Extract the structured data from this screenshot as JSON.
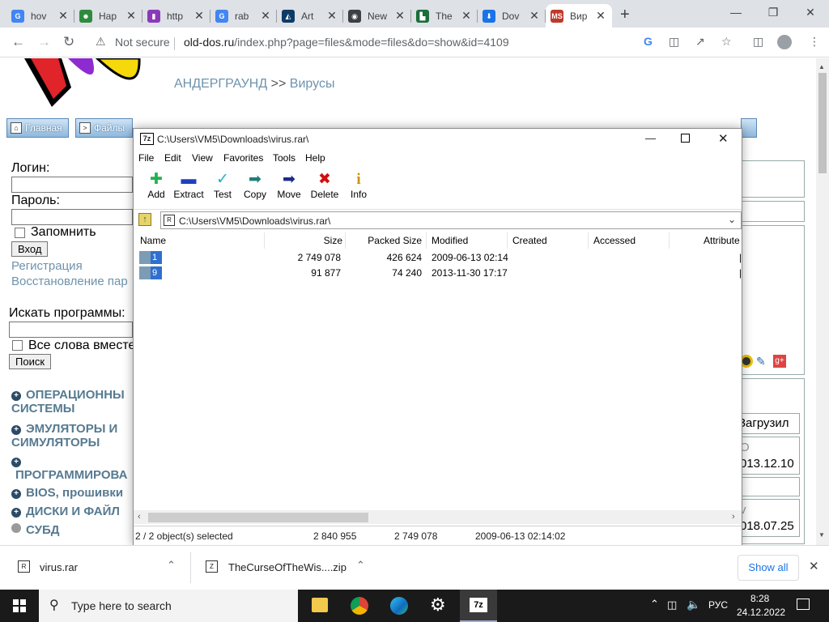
{
  "browser": {
    "tabs": [
      {
        "title": "hov",
        "fav": "#4285f4",
        "glyph": "G"
      },
      {
        "title": "Hap",
        "fav": "#2e8b3e",
        "glyph": "☻"
      },
      {
        "title": "http",
        "fav": "#8a3ab9",
        "glyph": "▮"
      },
      {
        "title": "rab",
        "fav": "#4285f4",
        "glyph": "G"
      },
      {
        "title": "Art",
        "fav": "#0d3b66",
        "glyph": "◭"
      },
      {
        "title": "New",
        "fav": "#3c4043",
        "glyph": "◉"
      },
      {
        "title": "The",
        "fav": "#1b6e3b",
        "glyph": "▙"
      },
      {
        "title": "Dov",
        "fav": "#1a73e8",
        "glyph": "⬇"
      },
      {
        "title": "Вир",
        "fav": "#c0392b",
        "glyph": "MS"
      }
    ],
    "new_tab": "+",
    "url_security": "Not secure",
    "url_host": "old-dos.ru",
    "url_path": "/index.php?page=files&mode=files&do=show&id=4109"
  },
  "site": {
    "breadcrumb_1": "АНДЕРГРАУНД",
    "breadcrumb_sep": ">>",
    "breadcrumb_2": "Вирусы",
    "nav": [
      "Главная",
      "Файлы"
    ],
    "login_label": "Логин:",
    "password_label": "Пароль:",
    "remember_label": "Запомнить",
    "login_button": "Вход",
    "register_link": "Регистрация",
    "restore_link": "Восстановление пар",
    "search_label": "Искать программы:",
    "allwords_label": "Все слова вместе",
    "search_button": "Поиск",
    "categories": [
      "ОПЕРАЦИОННЫ СИСТЕМЫ",
      "ЭМУЛЯТОРЫ И СИМУЛЯТОРЫ",
      "ПРОГРАММИРОВА",
      "BIOS, прошивки",
      "ДИСКИ И ФАЙЛ",
      "СУБД"
    ],
    "right_uploaded": "Загрузил",
    "right_date1": "013.12.10",
    "right_date2": "018.07.25",
    "right_o": "O",
    "right_v": "v"
  },
  "sevenzip": {
    "title": "C:\\Users\\VM5\\Downloads\\virus.rar\\",
    "menu": [
      "File",
      "Edit",
      "View",
      "Favorites",
      "Tools",
      "Help"
    ],
    "toolbar": [
      {
        "label": "Add",
        "icon": "plus-icon",
        "color": "#22b14c",
        "glyph": "✚"
      },
      {
        "label": "Extract",
        "icon": "minus-icon",
        "color": "#1f3fbf",
        "glyph": "▬"
      },
      {
        "label": "Test",
        "icon": "check-icon",
        "color": "#20b2c2",
        "glyph": "✓"
      },
      {
        "label": "Copy",
        "icon": "copy-arrow-icon",
        "color": "#1e7d7d",
        "glyph": "➡"
      },
      {
        "label": "Move",
        "icon": "move-arrow-icon",
        "color": "#1b2a8c",
        "glyph": "➡"
      },
      {
        "label": "Delete",
        "icon": "delete-icon",
        "color": "#d01010",
        "glyph": "✖"
      },
      {
        "label": "Info",
        "icon": "info-icon",
        "color": "#c99400",
        "glyph": "i"
      }
    ],
    "path": "C:\\Users\\VM5\\Downloads\\virus.rar\\",
    "columns": [
      "Name",
      "Size",
      "Packed Size",
      "Modified",
      "Created",
      "Accessed",
      "Attribute"
    ],
    "rows": [
      {
        "name": "1",
        "size": "2 749 078",
        "packed": "426 624",
        "modified": "2009-06-13 02:14"
      },
      {
        "name": "9",
        "size": "91 877",
        "packed": "74 240",
        "modified": "2013-11-30 17:17"
      }
    ],
    "status": {
      "selected": "2 / 2 object(s) selected",
      "size": "2 840 955",
      "packed": "2 749 078",
      "modified": "2009-06-13 02:14:02"
    }
  },
  "downloads": {
    "item1": "virus.rar",
    "item2": "TheCurseOfTheWis....zip",
    "show_all": "Show all"
  },
  "taskbar": {
    "search_placeholder": "Type here to search",
    "lang": "РУС",
    "time": "8:28",
    "date": "24.12.2022"
  }
}
